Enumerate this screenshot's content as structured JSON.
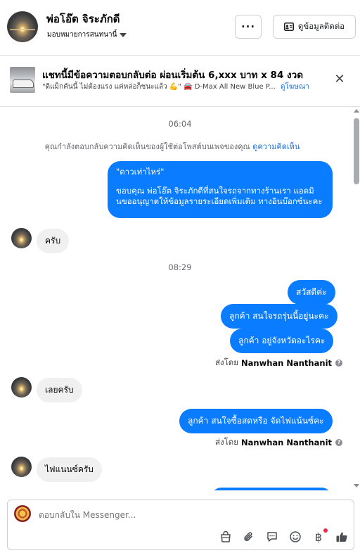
{
  "header": {
    "name": "พ่อโอ๊ต จิระภักดี",
    "assign_label": "มอบหมายการสนทนานี้",
    "more_label": "···",
    "contact_label": "ดูข้อมูลติดต่อ"
  },
  "ad": {
    "title": "แชทนี้มีข้อความตอบกลับต่อ ผ่อนเริ่มต้น 6,xxx บาท x 84 งวด",
    "subtitle": "\"ดิแม็กคันนี้ ไม่ต้องแรง แค่หล่อก็ชนะแล้ว 💪\" 🚘 D-Max All New Blue P...",
    "link": "ดูโฆษณา",
    "close": "✕"
  },
  "chat": {
    "time1": "06:04",
    "notice_text": "คุณกำลังตอบกลับความคิดเห็นของผู้ใช้ต่อโพสต์บนเพจของคุณ",
    "notice_link": "ดูความคิดเห็น",
    "out1_line1": "\"ดาวเท่าไหร่\"",
    "out1_line2": "ขอบคุณ พ่อโอ๊ต จิระภักดีที่สนใจรถจากทางร้านเรา แอดมิ",
    "out1_line3": "นขออนุญาตให้ข้อมูลรายระเอียดเพิ่มเติม ทางอินบ๊อกซ์นะคะ",
    "in1": "ครับ",
    "time2": "08:29",
    "out2": "สวัสดีค่ะ",
    "out3": "ลูกค้า สนใจรถรุ่นนี้อยู่นะคะ",
    "out4": "ลูกค้า  อยู่จังหวัดอะไรคะ",
    "sent_prefix": "ส่งโดย",
    "sender": "Nanwhan Nanthanit",
    "in2": "เลยครับ",
    "out5": "ลูกค้า  สนใจซื้อสดหรือ จัดไฟแน้นซ์คะ",
    "in3": "ไฟแนนซ์ครับ"
  },
  "composer": {
    "placeholder": "ตอบกลับใน Messenger...",
    "icons": [
      "bag-icon",
      "paperclip-icon",
      "speech-bubble-icon",
      "smiley-icon",
      "baht-icon",
      "thumbs-up-icon"
    ],
    "baht_symbol": "฿"
  },
  "colors": {
    "accent": "#0a7cff",
    "link": "#216fdb",
    "incoming_bubble": "#f0f0f0"
  }
}
